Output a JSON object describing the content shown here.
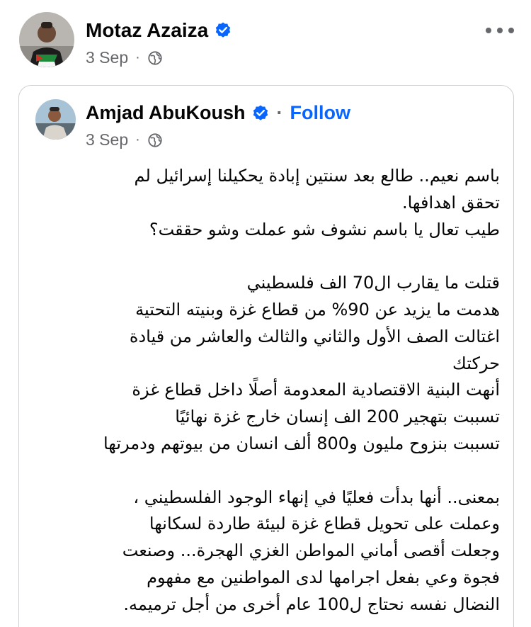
{
  "outer_post": {
    "author": "Motaz Azaiza",
    "date": "3 Sep",
    "dot": "·"
  },
  "shared_post": {
    "author": "Amjad AbuKoush",
    "separator": "·",
    "follow_label": "Follow",
    "date": "3 Sep",
    "dot": "·",
    "text_lines": [
      "باسم نعيم.. طالع بعد سنتين إبادة يحكيلنا إسرائيل لم",
      "تحقق اهدافها.",
      "طيب تعال يا باسم نشوف شو عملت وشو حققت؟",
      "",
      "قتلت ما يقارب ال70 الف فلسطيني",
      "هدمت ما يزيد عن 90% من قطاع غزة وبنيته التحتية",
      "اغتالت الصف الأول والثاني والثالث والعاشر من قيادة",
      "حركتك",
      "أنهت البنية الاقتصادية المعدومة أصلًا داخل قطاع غزة",
      "تسببت بتهجير 200 الف إنسان خارج غزة نهائيًا",
      "تسببت بنزوح مليون و800 ألف انسان من بيوتهم ودمرتها",
      "",
      "بمعنى.. أنها بدأت فعليًا في إنهاء الوجود الفلسطيني ،",
      "وعملت على تحويل قطاع غزة لبيئة طاردة لسكانها",
      "وجعلت أقصى أماني المواطن الغزي الهجرة... وصنعت",
      "فجوة وعي بفعل اجرامها لدى المواطنين مع مفهوم",
      "النضال نفسه نحتاج ل100 عام أخرى من أجل ترميمه."
    ]
  },
  "colors": {
    "text": "#050505",
    "secondary": "#65676b",
    "link": "#0866ff",
    "border": "#ced0d4"
  },
  "icons": {
    "verified": "verified-badge-icon",
    "audience": "globe-icon",
    "more": "more-horizontal-icon"
  }
}
